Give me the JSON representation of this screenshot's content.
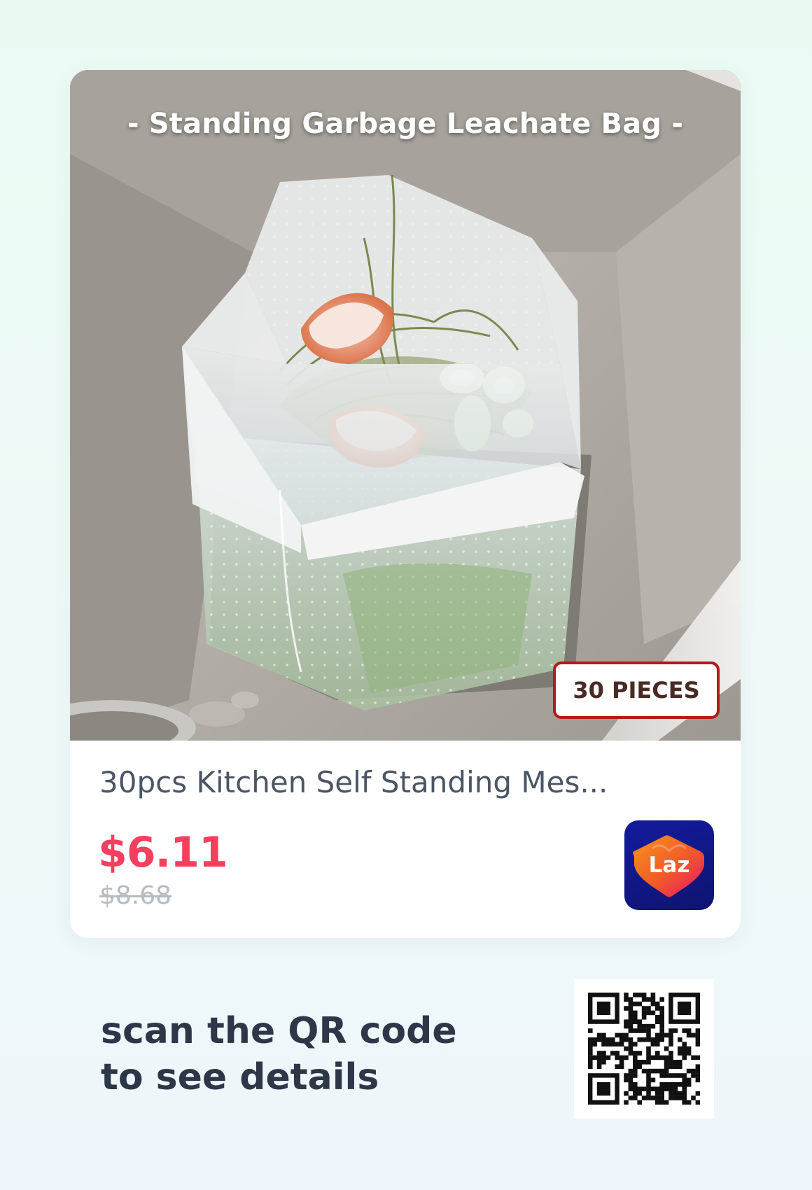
{
  "product": {
    "image_caption": "- Standing Garbage Leachate Bag -",
    "image_badge": "30 PIECES",
    "title": "30pcs Kitchen Self Standing Mes...",
    "price": "$6.11",
    "original_price": "$8.68"
  },
  "store": {
    "logo_text": "Laz",
    "logo_icon": "lazada-heart-icon"
  },
  "cta": {
    "line1": "scan the QR code",
    "line2": "to see details"
  },
  "colors": {
    "price": "#f43f5e",
    "old_price": "#b6bac1",
    "title": "#4b5563",
    "cta_text": "#2d3748",
    "badge_border": "#b31b1b",
    "lazada_bg": "#141b9d",
    "lazada_heart_start": "#f37021",
    "lazada_heart_end": "#e8116b"
  }
}
